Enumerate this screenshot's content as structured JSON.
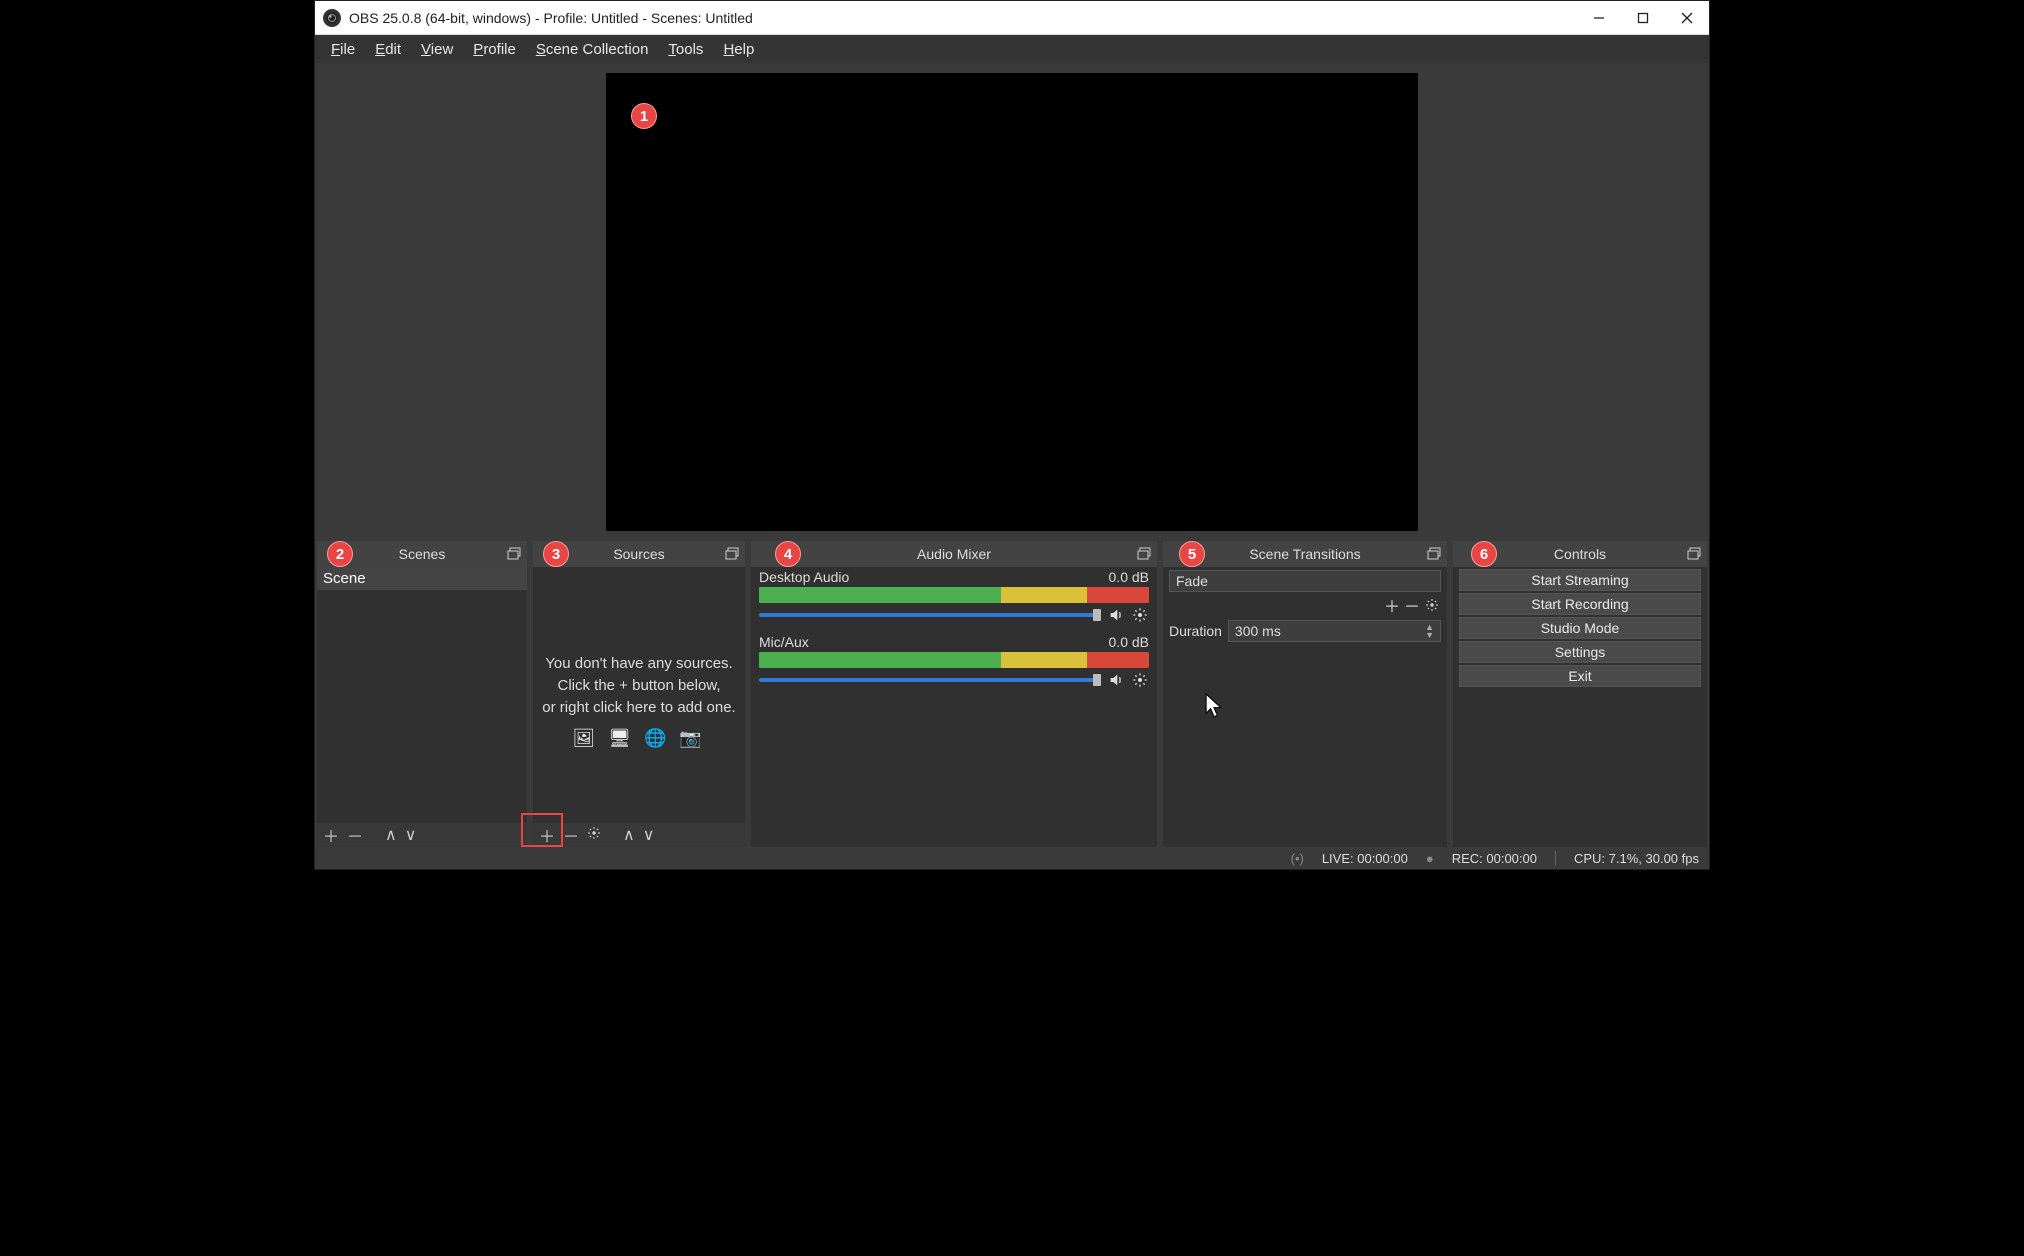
{
  "window": {
    "title": "OBS 25.0.8 (64-bit, windows) - Profile: Untitled - Scenes: Untitled"
  },
  "menu": {
    "file": "File",
    "edit": "Edit",
    "view": "View",
    "profile": "Profile",
    "scene_collection": "Scene Collection",
    "tools": "Tools",
    "help": "Help"
  },
  "annotations": {
    "b1": "1",
    "b2": "2",
    "b3": "3",
    "b4": "4",
    "b5": "5",
    "b6": "6"
  },
  "panels": {
    "scenes": {
      "title": "Scenes",
      "items": [
        "Scene"
      ]
    },
    "sources": {
      "title": "Sources",
      "empty1": "You don't have any sources.",
      "empty2": "Click the + button below,",
      "empty3": "or right click here to add one."
    },
    "mixer": {
      "title": "Audio Mixer",
      "channels": [
        {
          "name": "Desktop Audio",
          "db": "0.0 dB"
        },
        {
          "name": "Mic/Aux",
          "db": "0.0 dB"
        }
      ]
    },
    "transitions": {
      "title": "Scene Transitions",
      "selected": "Fade",
      "duration_label": "Duration",
      "duration_value": "300 ms"
    },
    "controls": {
      "title": "Controls",
      "start_streaming": "Start Streaming",
      "start_recording": "Start Recording",
      "studio_mode": "Studio Mode",
      "settings": "Settings",
      "exit": "Exit"
    }
  },
  "status": {
    "live": "LIVE: 00:00:00",
    "rec": "REC: 00:00:00",
    "cpu": "CPU: 7.1%, 30.00 fps"
  }
}
